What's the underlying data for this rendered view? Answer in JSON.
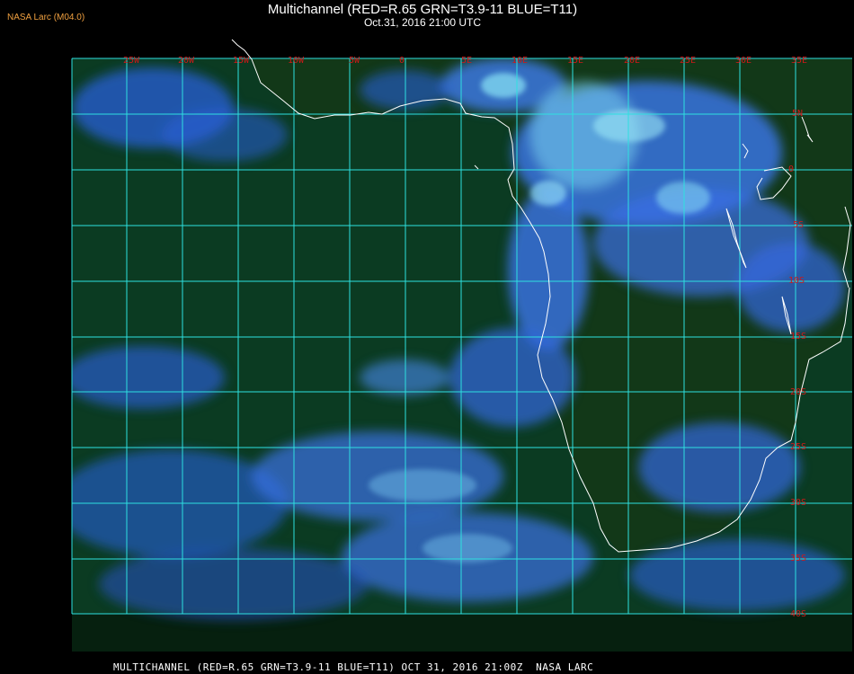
{
  "header": {
    "badge": "NASA Larc (M04.0)",
    "title": "Multichannel (RED=R.65 GRN=T3.9-11 BLUE=T11)",
    "subtitle": "Oct.31, 2016 21:00 UTC"
  },
  "footer": {
    "text": "MULTICHANNEL (RED=R.65 GRN=T3.9-11 BLUE=T11) OCT 31, 2016 21:00Z  NASA LARC"
  },
  "map": {
    "colors": {
      "ocean": "#0c3a20",
      "land": "#123618",
      "grid": "#2ee0e0",
      "coast": "#ffffff",
      "cloud": "#2f66e8",
      "cloud_bright": "#6fd8f0",
      "label": "#d01818"
    },
    "lon_labels": [
      "25W",
      "20W",
      "15W",
      "10W",
      "5W",
      "0",
      "5E",
      "10E",
      "15E",
      "20E",
      "25E",
      "30E",
      "35E"
    ],
    "lat_labels": [
      "5N",
      "0",
      "5S",
      "10S",
      "15S",
      "20S",
      "25S",
      "30S",
      "35S",
      "40S"
    ]
  }
}
